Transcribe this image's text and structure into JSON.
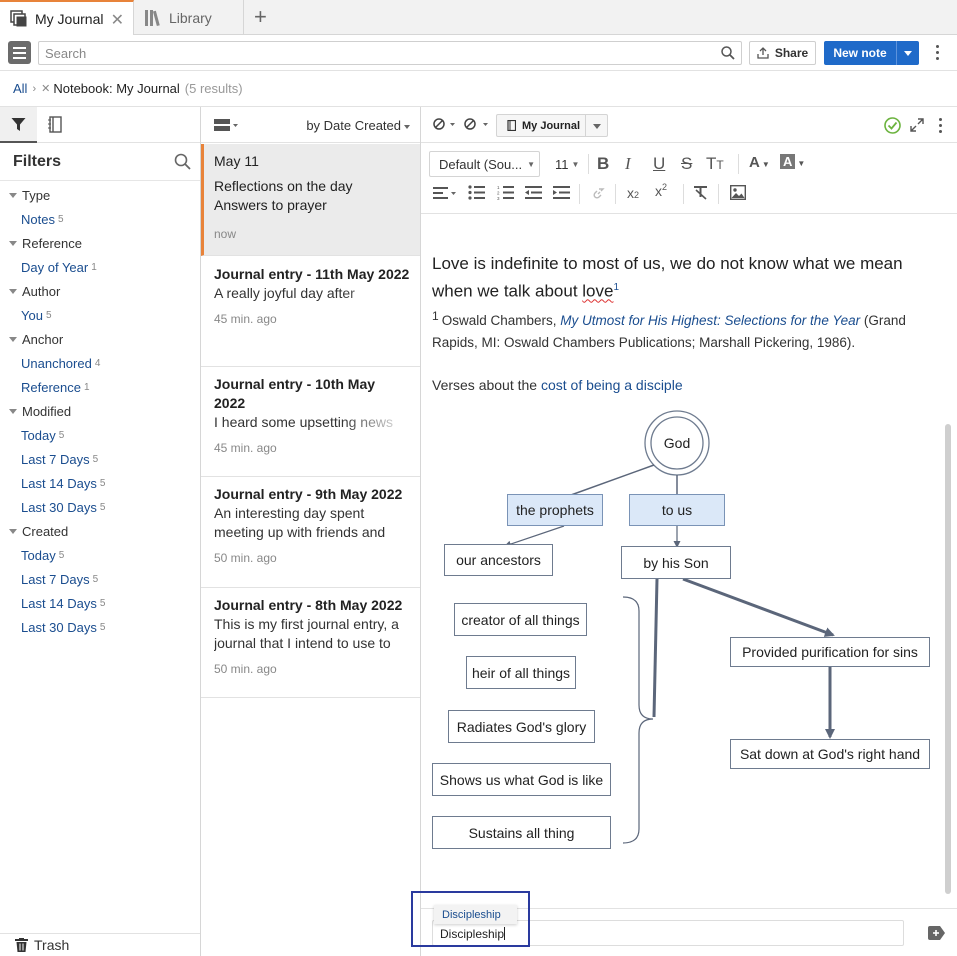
{
  "tabs": [
    {
      "label": "My Journal",
      "active": true
    },
    {
      "label": "Library",
      "active": false
    }
  ],
  "toolbar": {
    "search_placeholder": "Search",
    "share_label": "Share",
    "new_note_label": "New note"
  },
  "breadcrumb": {
    "root": "All",
    "filter_label": "Notebook: My Journal",
    "count": "(5 results)"
  },
  "filters": {
    "title": "Filters",
    "groups": [
      {
        "label": "Type",
        "items": [
          {
            "label": "Notes",
            "count": "5"
          }
        ]
      },
      {
        "label": "Reference",
        "items": [
          {
            "label": "Day of Year",
            "count": "1"
          }
        ]
      },
      {
        "label": "Author",
        "items": [
          {
            "label": "You",
            "count": "5"
          }
        ]
      },
      {
        "label": "Anchor",
        "items": [
          {
            "label": "Unanchored",
            "count": "4"
          },
          {
            "label": "Reference",
            "count": "1"
          }
        ]
      },
      {
        "label": "Modified",
        "items": [
          {
            "label": "Today",
            "count": "5"
          },
          {
            "label": "Last 7 Days",
            "count": "5"
          },
          {
            "label": "Last 14 Days",
            "count": "5"
          },
          {
            "label": "Last 30 Days",
            "count": "5"
          }
        ]
      },
      {
        "label": "Created",
        "items": [
          {
            "label": "Today",
            "count": "5"
          },
          {
            "label": "Last 7 Days",
            "count": "5"
          },
          {
            "label": "Last 14 Days",
            "count": "5"
          },
          {
            "label": "Last 30 Days",
            "count": "5"
          }
        ]
      }
    ],
    "trash_label": "Trash"
  },
  "notes_list": {
    "sort_label": "by Date Created",
    "notes": [
      {
        "title": "May 11",
        "snippet1": "Reflections on the day",
        "snippet2": "Answers to prayer",
        "time": "now"
      },
      {
        "title": "Journal entry - 11th May 2022",
        "snippet": "A really joyful day after",
        "time": "45 min. ago"
      },
      {
        "title": "Journal entry - 10th May 2022",
        "snippet": "I heard some upsetting news",
        "time": "45 min. ago"
      },
      {
        "title": "Journal entry - 9th May 2022",
        "snippet": "An interesting day spent meeting up with friends and",
        "time": "50 min. ago"
      },
      {
        "title": "Journal entry - 8th May 2022",
        "snippet": "This is my first journal entry, a journal that I intend to use to",
        "time": "50 min. ago"
      }
    ]
  },
  "editor": {
    "notebook_label": "My Journal",
    "font_label": "Default (Sou...",
    "font_size": "11",
    "heading_before": "Love is indefinite to most of us, we do not know what we mean when we talk about ",
    "heading_love": "love",
    "heading_sup": "1",
    "footnote_num": "1",
    "footnote_author": "Oswald Chambers, ",
    "footnote_title": "My Utmost for His Highest: Selections for the Year",
    "footnote_rest": " (Grand Rapids, MI: Oswald Chambers Publications; Marshall Pickering, 1986).",
    "verses_prefix": "Verses about the ",
    "verses_link": "cost of being a disciple"
  },
  "diagram": {
    "nodes": {
      "god": "God",
      "prophets": "the prophets",
      "to_us": "to us",
      "ancestors": "our ancestors",
      "son": "by his Son",
      "creator": "creator of all things",
      "heir": "heir of all things",
      "glory": "Radiates God's glory",
      "shows": "Shows us what God is like",
      "sustains": "Sustains all thing",
      "purification": "Provided purification for sins",
      "sat": "Sat down at God's right hand"
    }
  },
  "tags": {
    "suggestion": "Discipleship",
    "input_value": "Discipleship"
  },
  "colors": {
    "accent": "#e8833a",
    "primary_button": "#1f6ac9",
    "link": "#1a4d8f",
    "highlight_box": "#2a3a9e",
    "diagram_node_blue": "#dbe8f8"
  }
}
